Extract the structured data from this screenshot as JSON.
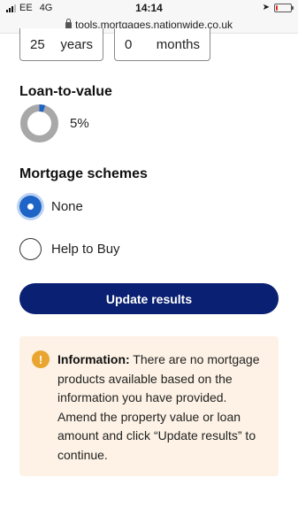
{
  "status_bar": {
    "carrier": "EE",
    "network": "4G",
    "time": "14:14",
    "battery_color": "#e0302b",
    "battery_level": 0.15
  },
  "url_bar": {
    "url": "tools.mortgages.nationwide.co.uk"
  },
  "term": {
    "years_value": "25",
    "years_unit": "years",
    "months_value": "0",
    "months_unit": "months"
  },
  "ltv": {
    "title": "Loan-to-value",
    "value_text": "5%",
    "fraction": 0.05,
    "ring_color": "#a8a8a8",
    "fill_color": "#1e63c6"
  },
  "schemes": {
    "title": "Mortgage schemes",
    "options": [
      {
        "label": "None",
        "selected": true
      },
      {
        "label": "Help to Buy",
        "selected": false
      }
    ]
  },
  "update_button": {
    "label": "Update results",
    "color": "#0a2072"
  },
  "info": {
    "heading": "Information:",
    "message": "There are no mortgage products available based on the information you have provided. Amend the property value or loan amount and click “Update results” to continue.",
    "background": "#fdf2e5",
    "icon": "warning-icon",
    "icon_glyph": "!",
    "icon_color": "#e9a530"
  }
}
